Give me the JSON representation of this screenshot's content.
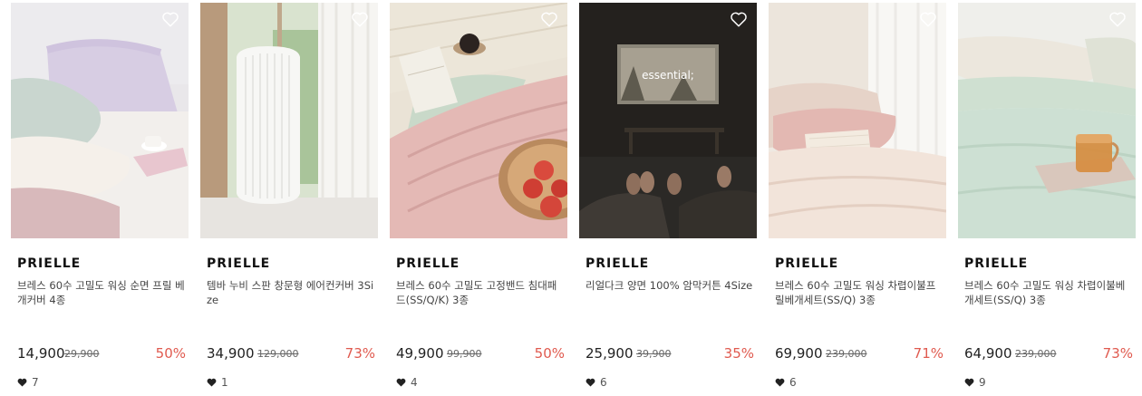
{
  "products": [
    {
      "brand": "PRIELLE",
      "title": "브레스 60수 고밀도 워싱 순면 프릴 베개커버 4종",
      "price": "14,900",
      "original_price": "29,900",
      "discount": "50%",
      "likes": "7",
      "image": "lavender-frill-pillow-bedroom"
    },
    {
      "brand": "PRIELLE",
      "title": "템바 누비 스판 창문형 에어컨커버 3Size",
      "price": "34,900",
      "original_price": "129,000",
      "discount": "73%",
      "likes": "1",
      "image": "white-quilted-window-ac-cover"
    },
    {
      "brand": "PRIELLE",
      "title": "브레스 60수 고밀도 고정밴드 침대패드(SS/Q/K) 3종",
      "price": "49,900",
      "original_price": "99,900",
      "discount": "50%",
      "likes": "4",
      "image": "pink-quilted-mattress-pad-apples"
    },
    {
      "brand": "PRIELLE",
      "title": "리얼다크 양면 100% 암막커튼 4Size",
      "price": "25,900",
      "original_price": "39,900",
      "discount": "35%",
      "likes": "6",
      "image": "dark-room-projector-screen",
      "screen_text": "essential;"
    },
    {
      "brand": "PRIELLE",
      "title": "브레스 60수 고밀도 워싱 차렵이불프릴베개세트(SS/Q) 3종",
      "price": "69,900",
      "original_price": "239,000",
      "discount": "71%",
      "likes": "6",
      "image": "pink-beige-bedding-set"
    },
    {
      "brand": "PRIELLE",
      "title": "브레스 60수 고밀도 워싱 차렵이불베개세트(SS/Q) 3종",
      "price": "64,900",
      "original_price": "239,000",
      "discount": "73%",
      "likes": "9",
      "image": "mint-bedding-with-tea"
    }
  ],
  "icons": {
    "wishlist": "heart-outline-icon",
    "likes": "heart-filled-icon"
  },
  "colors": {
    "discount": "#e05a4f",
    "text": "#222222",
    "muted": "#666666"
  }
}
